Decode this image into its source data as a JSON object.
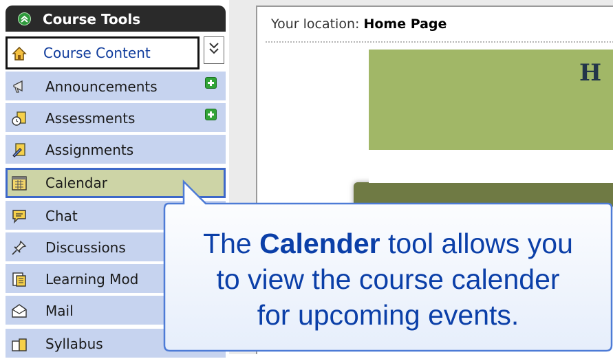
{
  "sidebar": {
    "title": "Course Tools",
    "items": [
      {
        "label": "Course Content",
        "icon": "home-icon"
      },
      {
        "label": "Announcements",
        "icon": "megaphone-icon",
        "new": true
      },
      {
        "label": "Assessments",
        "icon": "assessment-icon",
        "new": true
      },
      {
        "label": "Assignments",
        "icon": "assignment-icon"
      },
      {
        "label": "Calendar",
        "icon": "calendar-icon"
      },
      {
        "label": "Chat",
        "icon": "chat-bubble-icon"
      },
      {
        "label": "Discussions",
        "icon": "pushpin-icon"
      },
      {
        "label": "Learning Mod",
        "icon": "learning-module-icon"
      },
      {
        "label": "Mail",
        "icon": "mail-icon"
      },
      {
        "label": "Syllabus",
        "icon": "syllabus-icon"
      }
    ]
  },
  "location": {
    "prefix": "Your location: ",
    "value": "Home Page"
  },
  "banner": {
    "text": "H"
  },
  "callout": {
    "line1_pre": "The ",
    "line1_bold": "Calender",
    "line1_post": " tool allows you",
    "line2": "to view the course calender",
    "line3": "for upcoming events."
  },
  "colors": {
    "sidebar_item_bg": "#c6d3ef",
    "selected_item_bg": "#cdd4a6",
    "selected_border": "#3d68c9",
    "banner_green": "#a1b767",
    "callout_text": "#0b3fa8"
  }
}
